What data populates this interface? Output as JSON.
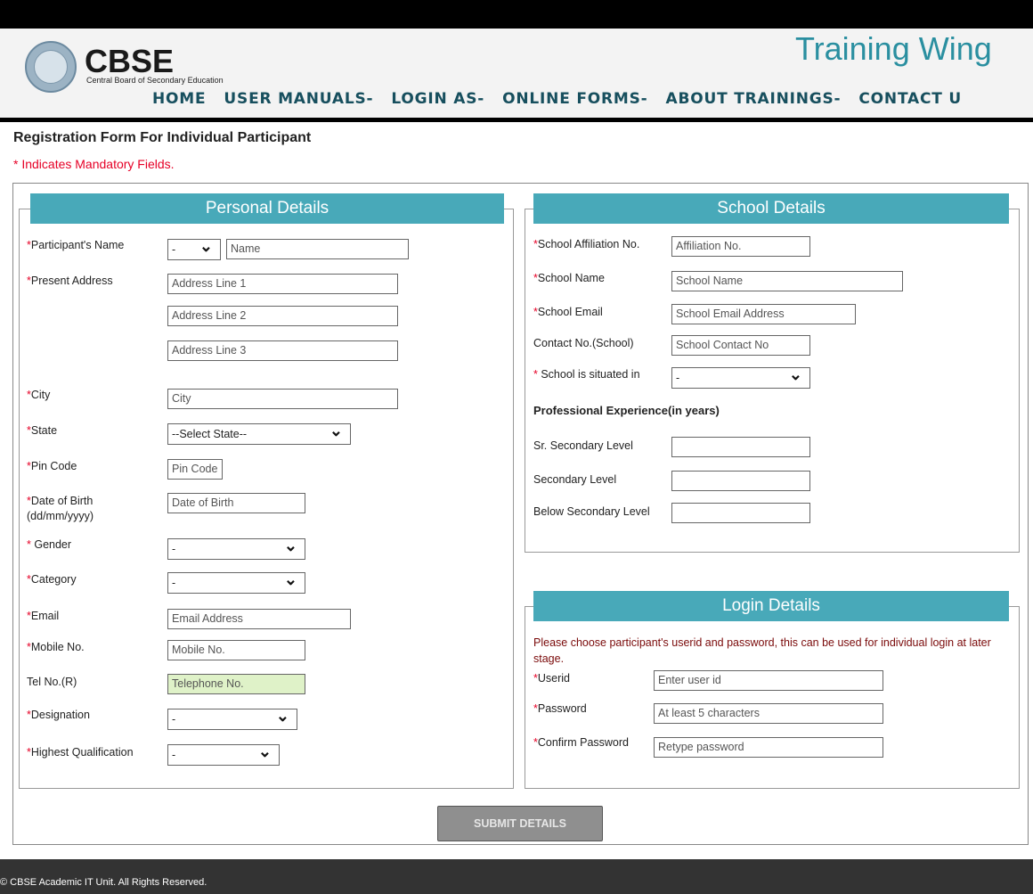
{
  "header": {
    "logo_text": "CBSE",
    "logo_subtitle": "Central Board of Secondary Education",
    "wing_title": "Training Wing",
    "nav": [
      "HOME",
      "USER MANUALS-",
      "LOGIN AS-",
      "ONLINE FORMS-",
      "ABOUT TRAININGS-",
      "CONTACT U"
    ]
  },
  "form": {
    "title": "Registration Form For Individual Participant",
    "mandatory_note": "* Indicates Mandatory Fields."
  },
  "personal": {
    "legend": "Personal Details",
    "name_label": "Participant's Name",
    "title_select": "-",
    "name_placeholder": "Name",
    "address_label": "Present Address",
    "address1": "Address Line 1",
    "address2": "Address Line 2",
    "address3": "Address Line 3",
    "city_label": "City",
    "city_placeholder": "City",
    "state_label": "State",
    "state_select": "--Select State--",
    "pin_label": "Pin Code",
    "pin_placeholder": "Pin Code",
    "dob_label": "Date of Birth",
    "dob_format": "(dd/mm/yyyy)",
    "dob_placeholder": "Date of Birth",
    "gender_label": " Gender",
    "gender_select": "-",
    "category_label": "Category",
    "category_select": "-",
    "email_label": "Email",
    "email_placeholder": "Email Address",
    "mobile_label": "Mobile No.",
    "mobile_placeholder": "Mobile No.",
    "tel_label": "Tel No.(R)",
    "tel_placeholder": "Telephone No.",
    "designation_label": "Designation",
    "designation_select": "-",
    "qualification_label": "Highest Qualification",
    "qualification_select": "-"
  },
  "school": {
    "legend": "School Details",
    "affiliation_label": "School Affiliation No.",
    "affiliation_placeholder": "Affiliation No.",
    "name_label": "School Name",
    "name_placeholder": "School Name",
    "email_label": "School Email",
    "email_placeholder": "School Email Address",
    "contact_label": "Contact No.(School)",
    "contact_placeholder": "School Contact No",
    "situated_label": " School is situated in",
    "situated_select": "-",
    "prof_exp_heading": "Professional Experience(in years)",
    "sr_secondary_label": "Sr. Secondary Level",
    "secondary_label": "Secondary Level",
    "below_secondary_label": "Below Secondary Level"
  },
  "login": {
    "legend": "Login Details",
    "note": "Please choose participant's userid and password, this can be used for individual login at later stage.",
    "userid_label": "Userid",
    "userid_placeholder": "Enter user id",
    "password_label": "Password",
    "password_placeholder": "At least 5 characters",
    "confirm_label": "Confirm Password",
    "confirm_placeholder": "Retype password"
  },
  "actions": {
    "submit_label": "SUBMIT DETAILS"
  },
  "footer": {
    "copyright": "© CBSE Academic IT Unit. All Rights Reserved."
  },
  "colors": {
    "accent": "#48a9b9",
    "required": "#e60026",
    "nav": "#174f5e"
  }
}
